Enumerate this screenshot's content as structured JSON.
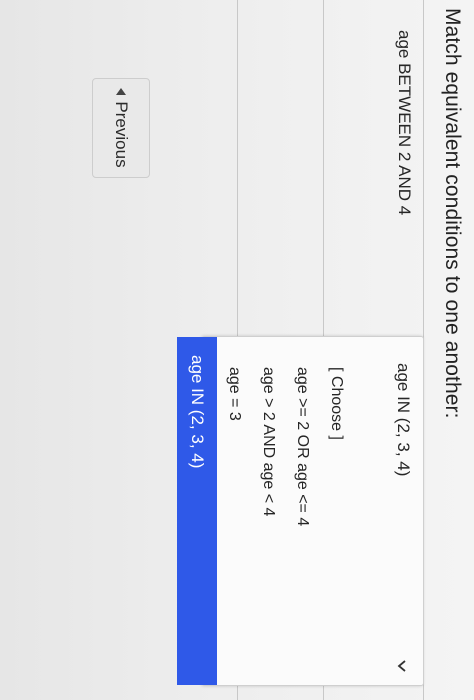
{
  "page": {
    "title": "Match equivalent conditions to one another:"
  },
  "match": {
    "prompt": "age BETWEEN 2 AND 4",
    "selected": "age IN (2, 3, 4)",
    "options": [
      "[ Choose ]",
      "age >= 2 OR age <= 4",
      "age > 2 AND age < 4",
      "age = 3",
      "age IN (2, 3, 4)"
    ],
    "highlighted_option": "age IN (2, 3, 4)",
    "highlight_color": "#2f59e8"
  },
  "nav": {
    "previous_label": "Previous",
    "previous_icon": "triangle-left-icon"
  },
  "dropdown_icon": "chevron-down-icon"
}
